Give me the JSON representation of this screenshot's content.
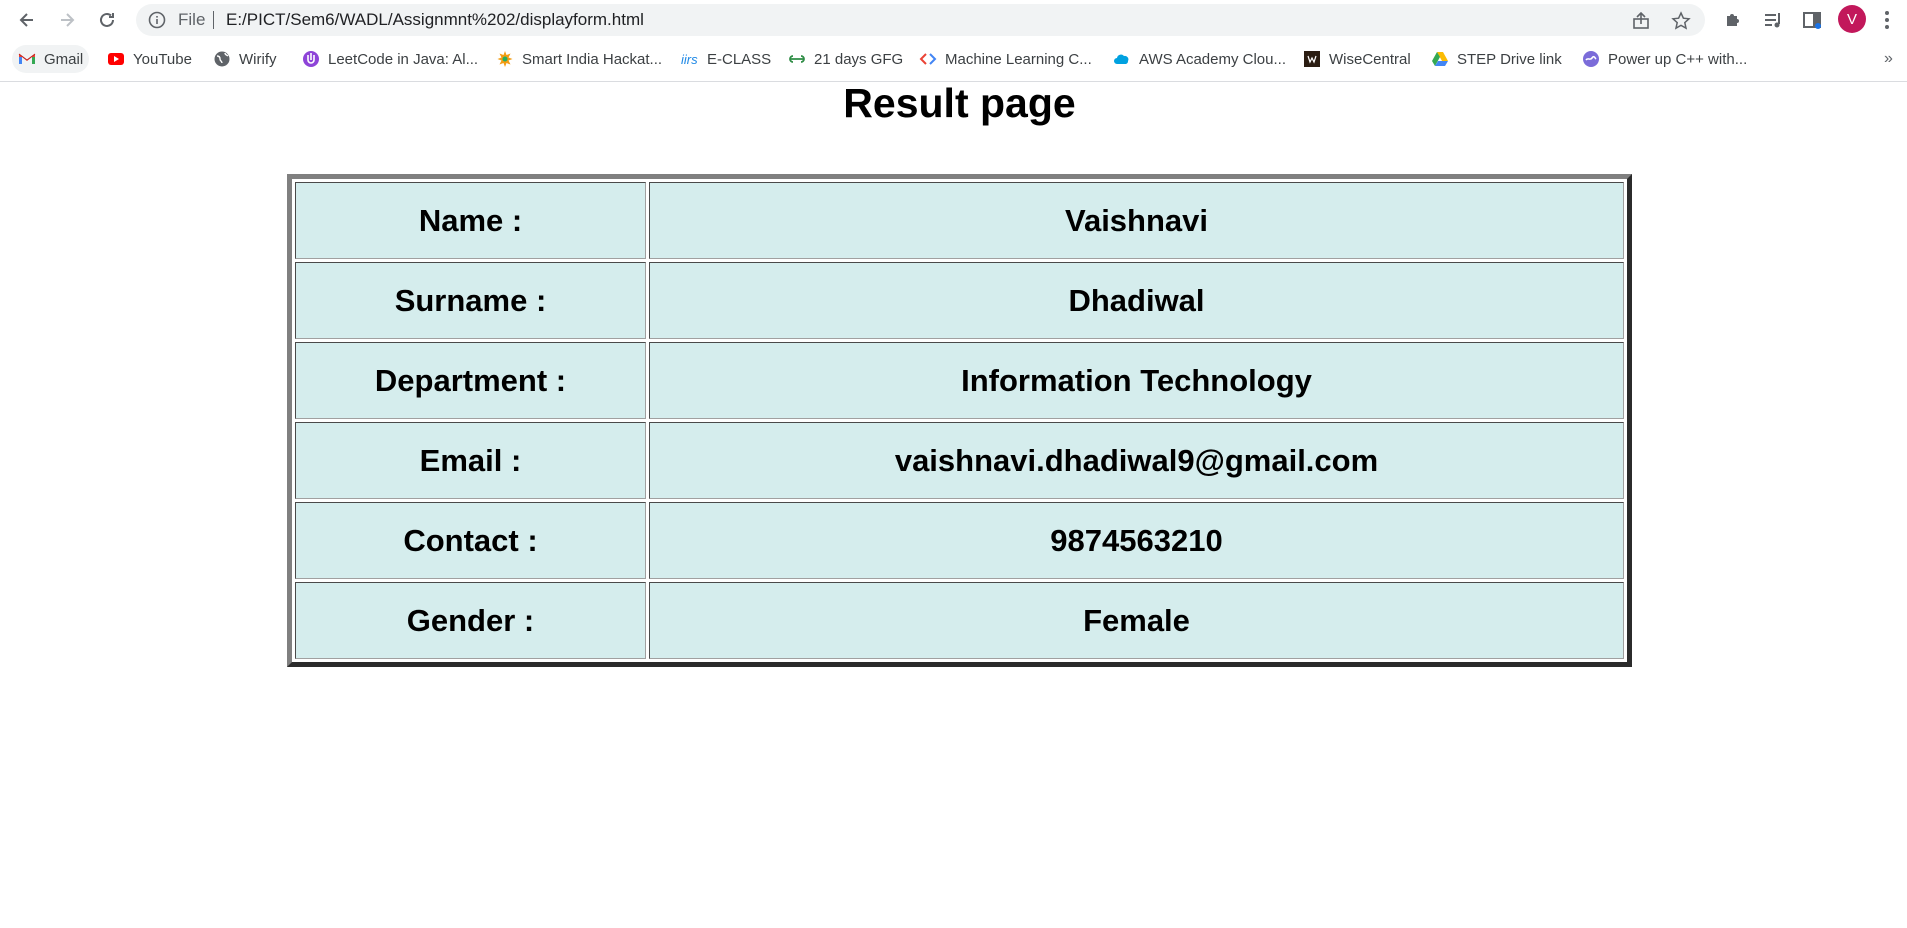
{
  "browser": {
    "omnibox": {
      "scheme_label": "File",
      "url": "E:/PICT/Sem6/WADL/Assignmnt%202/displayform.html"
    },
    "profile_initial": "V",
    "bookmarks": [
      {
        "label": "Gmail",
        "icon": "gmail-icon"
      },
      {
        "label": "YouTube",
        "icon": "youtube-icon"
      },
      {
        "label": "Wirify",
        "icon": "globe-icon"
      },
      {
        "label": "LeetCode in Java: Al...",
        "icon": "leetcode-icon"
      },
      {
        "label": "Smart India Hackat...",
        "icon": "sih-icon"
      },
      {
        "label": "E-CLASS",
        "icon": "iirs-icon"
      },
      {
        "label": "21 days GFG",
        "icon": "gfg-icon"
      },
      {
        "label": "Machine Learning C...",
        "icon": "code-brackets-icon"
      },
      {
        "label": "AWS Academy Clou...",
        "icon": "salesforce-cloud-icon"
      },
      {
        "label": "WiseCentral",
        "icon": "wisecentral-icon"
      },
      {
        "label": "STEP Drive link",
        "icon": "google-drive-icon"
      },
      {
        "label": "Power up C++ with...",
        "icon": "power-up-icon"
      }
    ]
  },
  "page": {
    "title": "Result page",
    "rows": [
      {
        "label": "Name :",
        "value": "Vaishnavi"
      },
      {
        "label": "Surname :",
        "value": "Dhadiwal"
      },
      {
        "label": "Department :",
        "value": "Information Technology"
      },
      {
        "label": "Email :",
        "value": "vaishnavi.dhadiwal9@gmail.com"
      },
      {
        "label": "Contact :",
        "value": "9874563210"
      },
      {
        "label": "Gender :",
        "value": "Female"
      }
    ]
  },
  "colors": {
    "cell_background": "#d5eded",
    "profile_avatar": "#c2185b",
    "omnibox_background": "#f1f3f4"
  }
}
